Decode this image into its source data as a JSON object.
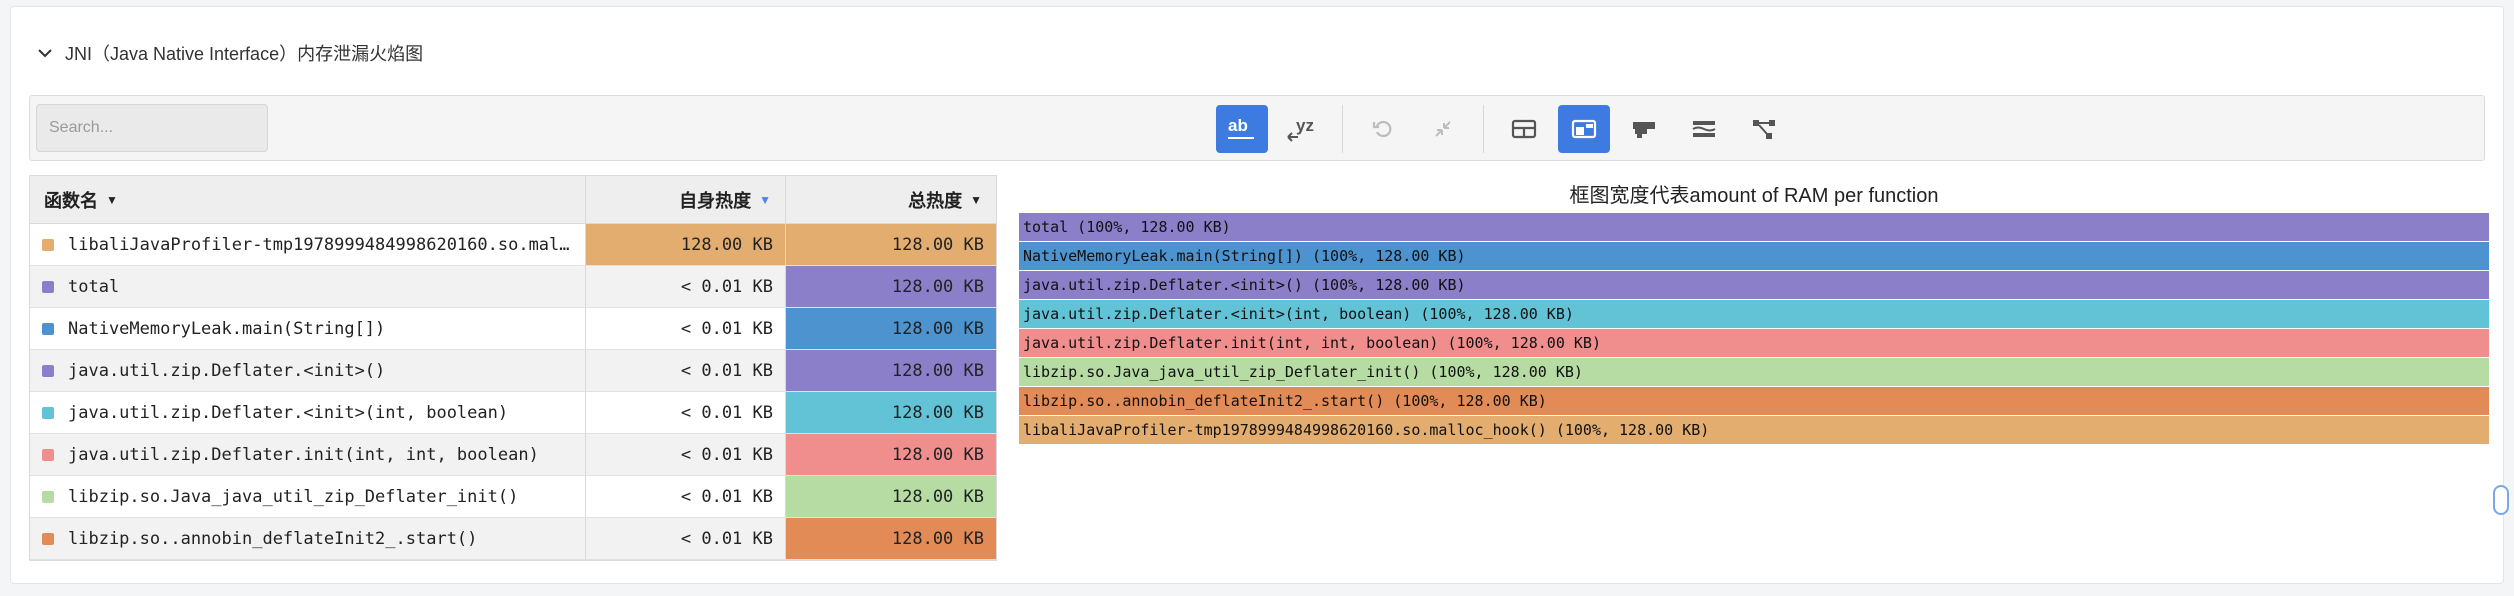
{
  "panel": {
    "title": "JNI（Java Native Interface）内存泄漏火焰图"
  },
  "toolbar": {
    "search_placeholder": "Search...",
    "buttons": {
      "ab": "ab",
      "yz": "yz"
    }
  },
  "table": {
    "headers": {
      "name": "函数名",
      "self": "自身热度",
      "total": "总热度"
    },
    "rows": [
      {
        "name": "libaliJavaProfiler-tmp1978999484998620160.so.malloc_hook()",
        "self": "128.00 KB",
        "total": "128.00 KB",
        "color": "#e3ad6f"
      },
      {
        "name": "total",
        "self": "< 0.01 KB",
        "total": "128.00 KB",
        "color": "#8b7fc9"
      },
      {
        "name": "NativeMemoryLeak.main(String[])",
        "self": "< 0.01 KB",
        "total": "128.00 KB",
        "color": "#4d93cf"
      },
      {
        "name": "java.util.zip.Deflater.<init>()",
        "self": "< 0.01 KB",
        "total": "128.00 KB",
        "color": "#8b7fc9"
      },
      {
        "name": "java.util.zip.Deflater.<init>(int, boolean)",
        "self": "< 0.01 KB",
        "total": "128.00 KB",
        "color": "#62c3d6"
      },
      {
        "name": "java.util.zip.Deflater.init(int, int, boolean)",
        "self": "< 0.01 KB",
        "total": "128.00 KB",
        "color": "#f08e8e"
      },
      {
        "name": "libzip.so.Java_java_util_zip_Deflater_init()",
        "self": "< 0.01 KB",
        "total": "128.00 KB",
        "color": "#b6dca4"
      },
      {
        "name": "libzip.so..annobin_deflateInit2_.start()",
        "self": "< 0.01 KB",
        "total": "128.00 KB",
        "color": "#e28b56"
      }
    ]
  },
  "flamegraph": {
    "title": "框图宽度代表amount of RAM per function",
    "frames": [
      {
        "label": "total (100%, 128.00 KB)",
        "color": "#8b7fc9"
      },
      {
        "label": "NativeMemoryLeak.main(String[]) (100%, 128.00 KB)",
        "color": "#4d93cf"
      },
      {
        "label": "java.util.zip.Deflater.<init>() (100%, 128.00 KB)",
        "color": "#8b7fc9"
      },
      {
        "label": "java.util.zip.Deflater.<init>(int, boolean) (100%, 128.00 KB)",
        "color": "#62c3d6"
      },
      {
        "label": "java.util.zip.Deflater.init(int, int, boolean) (100%, 128.00 KB)",
        "color": "#f08e8e"
      },
      {
        "label": "libzip.so.Java_java_util_zip_Deflater_init() (100%, 128.00 KB)",
        "color": "#b6dca4"
      },
      {
        "label": "libzip.so..annobin_deflateInit2_.start() (100%, 128.00 KB)",
        "color": "#e28b56"
      },
      {
        "label": "libaliJavaProfiler-tmp1978999484998620160.so.malloc_hook() (100%, 128.00 KB)",
        "color": "#e3ad6f"
      }
    ]
  },
  "colors": {
    "accent": "#3e7be0"
  }
}
